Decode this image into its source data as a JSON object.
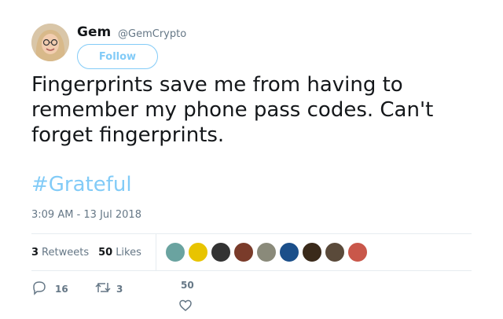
{
  "user": {
    "display_name": "Gem",
    "handle": "@GemCrypto",
    "follow_label": "Follow"
  },
  "tweet": {
    "text": "Fingerprints save me from having to remember my phone pass codes. Can't forget fingerprints.",
    "hashtag": "#Grateful",
    "timestamp": "3:09 AM - 13 Jul 2018"
  },
  "stats": {
    "retweets_count": "3",
    "retweets_label": "Retweets",
    "likes_count": "50",
    "likes_label": "Likes"
  },
  "likers": [
    "#6aa3a0",
    "#e8c400",
    "#333333",
    "#7a3b2a",
    "#8a8a7a",
    "#1b4f8a",
    "#3a2a1a",
    "#5a4a3a",
    "#c9574a"
  ],
  "actions": {
    "reply_count": "16",
    "retweet_count": "3",
    "like_count": "50"
  },
  "colors": {
    "accent": "#1da1f2",
    "muted": "#657786"
  }
}
